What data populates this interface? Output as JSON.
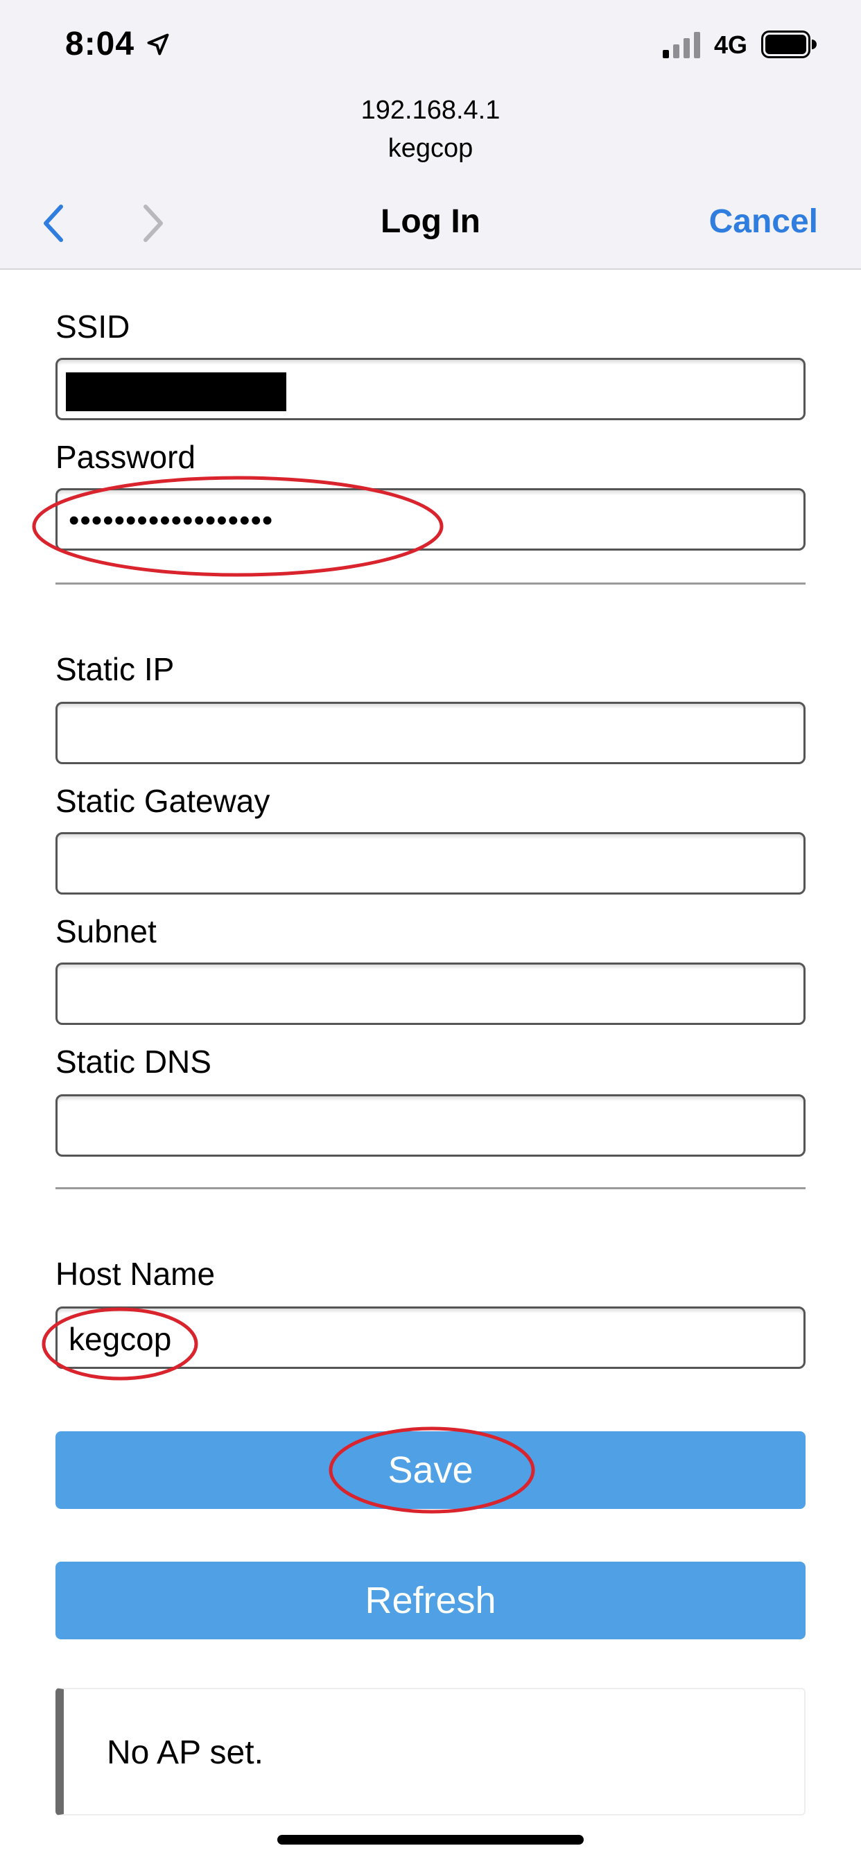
{
  "status_bar": {
    "time": "8:04",
    "network": "4G"
  },
  "browser": {
    "url": "192.168.4.1",
    "site_name": "kegcop",
    "nav_title": "Log In",
    "cancel_label": "Cancel"
  },
  "form": {
    "ssid_label": "SSID",
    "password_label": "Password",
    "password_value": "••••••••••••••••••",
    "static_ip_label": "Static IP",
    "static_gateway_label": "Static Gateway",
    "subnet_label": "Subnet",
    "static_dns_label": "Static DNS",
    "host_name_label": "Host Name",
    "host_name_value": "kegcop",
    "save_label": "Save",
    "refresh_label": "Refresh"
  },
  "message": {
    "text": "No AP set."
  },
  "colors": {
    "accent": "#2f7dde",
    "button": "#50a0e6",
    "annotation": "#d9232d"
  },
  "icons": [
    "location-arrow-icon",
    "signal-icon",
    "battery-icon",
    "back-chevron-icon",
    "forward-chevron-icon"
  ]
}
